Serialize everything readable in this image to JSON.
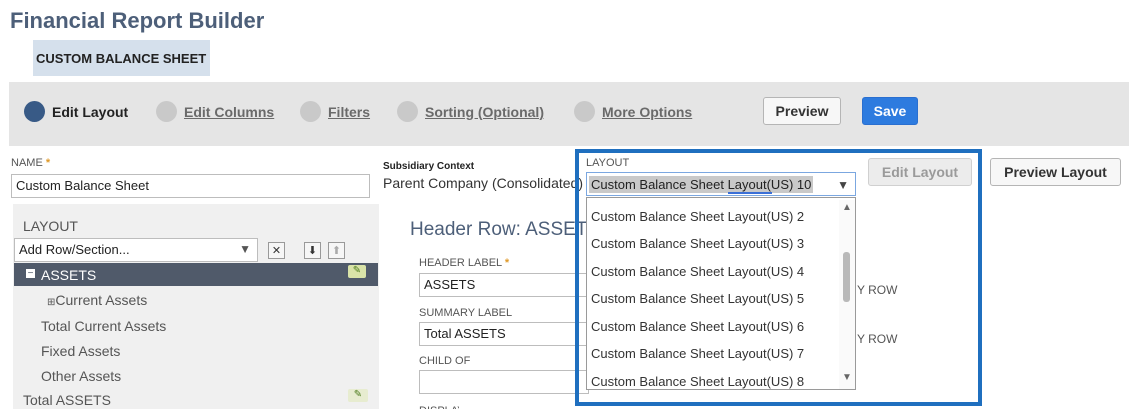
{
  "app": {
    "title": "Financial Report Builder",
    "record_name": "CUSTOM BALANCE SHEET"
  },
  "steps": [
    {
      "label": "Edit Layout",
      "active": true
    },
    {
      "label": "Edit Columns",
      "active": false
    },
    {
      "label": "Filters",
      "active": false
    },
    {
      "label": "Sorting (Optional)",
      "active": false
    },
    {
      "label": "More Options",
      "active": false
    }
  ],
  "toolbar": {
    "preview_label": "Preview",
    "save_label": "Save"
  },
  "name_field": {
    "label": "NAME",
    "value": "Custom Balance Sheet"
  },
  "subsidiary": {
    "label": "Subsidiary Context",
    "value": "Parent Company (Consolidated)"
  },
  "layout_field": {
    "label": "LAYOUT",
    "value": "Custom Balance Sheet Layout(US) 10",
    "edit_button": "Edit Layout",
    "preview_button": "Preview Layout",
    "options": [
      "Custom Balance Sheet Layout(US) 2",
      "Custom Balance Sheet Layout(US) 3",
      "Custom Balance Sheet Layout(US) 4",
      "Custom Balance Sheet Layout(US) 5",
      "Custom Balance Sheet Layout(US) 6",
      "Custom Balance Sheet Layout(US) 7",
      "Custom Balance Sheet Layout(US) 8"
    ]
  },
  "layout_panel": {
    "heading": "LAYOUT",
    "add_select": "Add Row/Section...",
    "tree": {
      "selected": "ASSETS",
      "current_assets": "Current Assets",
      "total_current_assets": "Total Current Assets",
      "fixed_assets": "Fixed Assets",
      "other_assets": "Other Assets",
      "total_assets": "Total ASSETS"
    }
  },
  "detail": {
    "heading": "Header Row: ASSETS",
    "header_label": "HEADER LABEL",
    "header_value": "ASSETS",
    "summary_label": "SUMMARY LABEL",
    "summary_value": "Total ASSETS",
    "child_of_label": "CHILD OF",
    "display_label": "DISPLAY",
    "partial_right_1": "Y ROW",
    "partial_right_2": "Y ROW"
  },
  "colors": {
    "accent": "#2d7bdf",
    "title": "#4d5f79",
    "highlight_border": "#1f6fbf",
    "active_step": "#385a86"
  }
}
